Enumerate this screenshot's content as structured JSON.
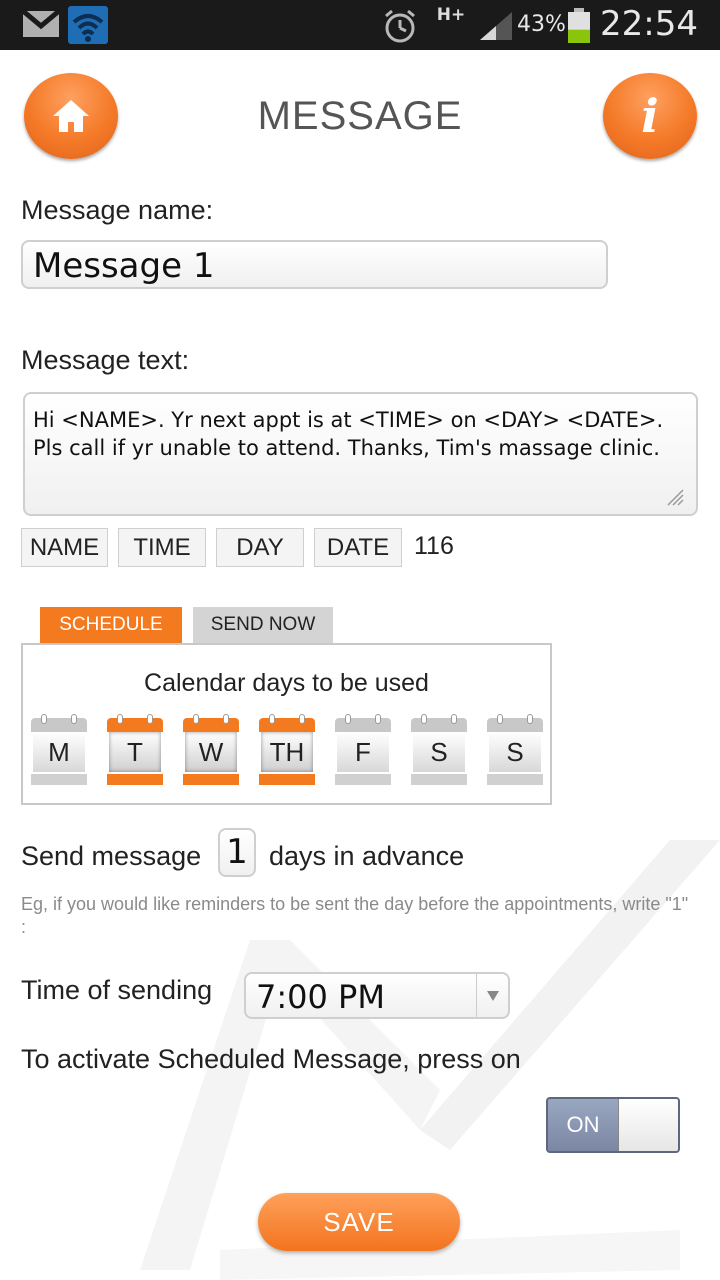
{
  "status_bar": {
    "network": "H+",
    "battery_percent": "43%",
    "battery_level": 0.43,
    "time": "22:54",
    "icons": [
      "gmail-icon",
      "wifi-icon",
      "alarm-icon",
      "signal-icon",
      "battery-icon"
    ]
  },
  "header": {
    "title": "MESSAGE",
    "home_icon": "home-icon",
    "info_icon": "info-icon",
    "info_glyph": "i"
  },
  "form": {
    "name_label": "Message name:",
    "name_value": "Message 1",
    "text_label": "Message text:",
    "text_value": "Hi <NAME>. Yr next appt is at <TIME> on <DAY> <DATE>. Pls call if yr unable to attend. Thanks, Tim's massage clinic.",
    "tags": [
      "NAME",
      "TIME",
      "DAY",
      "DATE"
    ],
    "char_count": "116"
  },
  "tabs": {
    "schedule": "SCHEDULE",
    "send_now": "SEND NOW",
    "active": "schedule"
  },
  "schedule": {
    "calendar_title": "Calendar days to be used",
    "days": [
      {
        "label": "M",
        "selected": false
      },
      {
        "label": "T",
        "selected": true
      },
      {
        "label": "W",
        "selected": true
      },
      {
        "label": "TH",
        "selected": true
      },
      {
        "label": "F",
        "selected": false
      },
      {
        "label": "S",
        "selected": false
      },
      {
        "label": "S",
        "selected": false
      }
    ],
    "advance_prefix": "Send message",
    "advance_value": "1",
    "advance_suffix": "days in advance",
    "hint": "Eg, if you would like reminders to be sent the day before the appointments, write \"1\" :",
    "time_label": "Time of sending",
    "time_value": "7:00 PM",
    "activate_label": "To activate Scheduled Message, press on",
    "toggle_label": "ON",
    "toggle_state": true
  },
  "save_label": "SAVE",
  "colors": {
    "accent": "#f47a20",
    "status_bar": "#1a1a1a",
    "toggle": "#8894b0"
  }
}
